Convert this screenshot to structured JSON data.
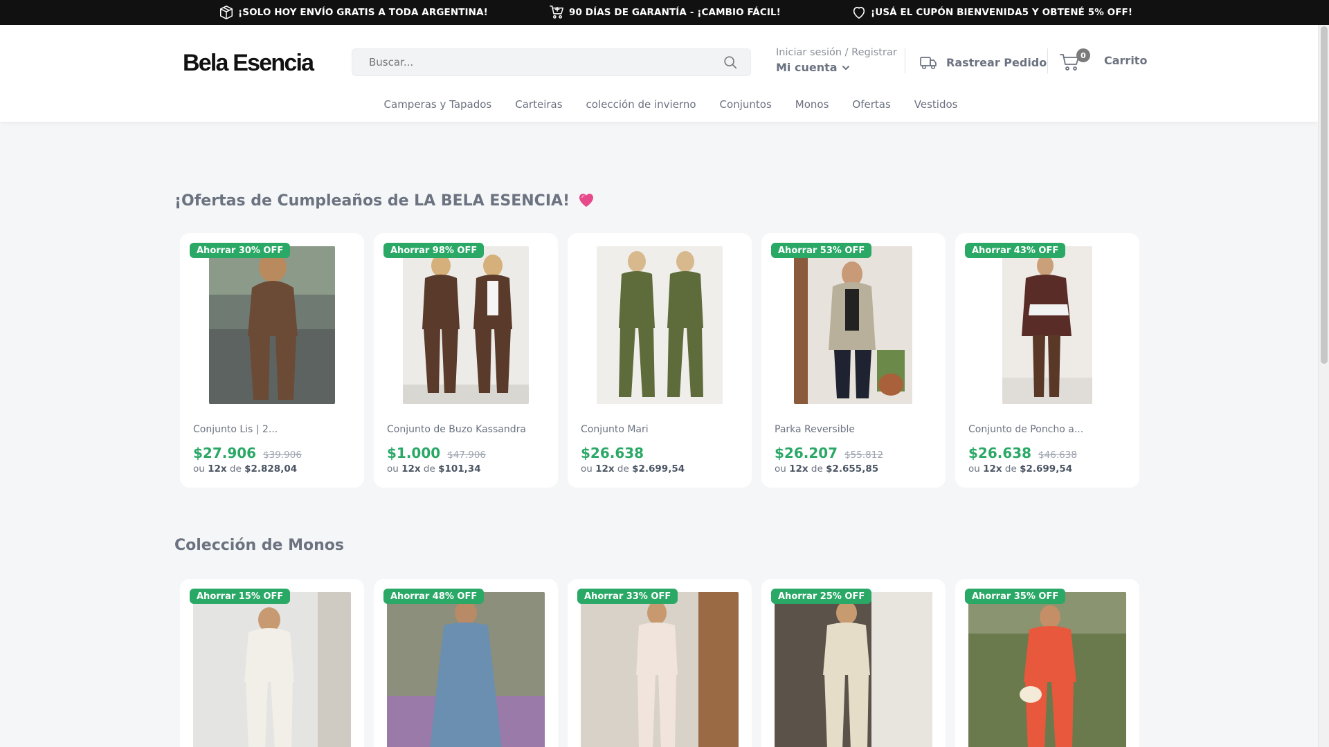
{
  "announcements": [
    {
      "text": "¡SOLO HOY ENVÍO GRATIS A TODA ARGENTINA!",
      "icon": "box-icon"
    },
    {
      "text": "90 DÍAS DE GARANTÍA - ¡CAMBIO FÁCIL!",
      "icon": "cart-icon"
    },
    {
      "text": "¡USÁ EL CUPÓN BIENVENIDA5 Y OBTENÉ 5% OFF!",
      "icon": "heart-icon"
    }
  ],
  "header": {
    "logo": "Bela Esencia",
    "search_placeholder": "Buscar...",
    "login": "Iniciar sesión / Registrar",
    "account": "Mi cuenta",
    "track": "Rastrear Pedido",
    "cart_count": "0",
    "cart_label": "Carrito"
  },
  "nav": [
    "Camperas y Tapados",
    "Carteiras",
    "colección de invierno",
    "Conjuntos",
    "Monos",
    "Ofertas",
    "Vestidos"
  ],
  "nav_first_icon": "",
  "sections": [
    {
      "title": "¡Ofertas de Cumpleaños de LA BELA ESENCIA!",
      "products": [
        {
          "badge": "Ahorrar 30% OFF",
          "name": "Conjunto Lis | 2...",
          "price": "$27.906",
          "old_price": "$39.906",
          "inst_prefix": "ou",
          "inst_count": "12x",
          "inst_de": "de",
          "inst_value": "$2.828,04"
        },
        {
          "badge": "Ahorrar 98% OFF",
          "name": "Conjunto de Buzo Kassandra",
          "price": "$1.000",
          "old_price": "$47.906",
          "inst_prefix": "ou",
          "inst_count": "12x",
          "inst_de": "de",
          "inst_value": "$101,34"
        },
        {
          "badge": "",
          "name": "Conjunto Mari",
          "price": "$26.638",
          "old_price": "",
          "inst_prefix": "ou",
          "inst_count": "12x",
          "inst_de": "de",
          "inst_value": "$2.699,54"
        },
        {
          "badge": "Ahorrar 53% OFF",
          "name": "Parka Reversible",
          "price": "$26.207",
          "old_price": "$55.812",
          "inst_prefix": "ou",
          "inst_count": "12x",
          "inst_de": "de",
          "inst_value": "$2.655,85"
        },
        {
          "badge": "Ahorrar 43% OFF",
          "name": "Conjunto de Poncho a...",
          "price": "$26.638",
          "old_price": "$46.638",
          "inst_prefix": "ou",
          "inst_count": "12x",
          "inst_de": "de",
          "inst_value": "$2.699,54"
        }
      ]
    },
    {
      "title": "Colección de Monos",
      "products": [
        {
          "badge": "Ahorrar 15% OFF"
        },
        {
          "badge": "Ahorrar 48% OFF"
        },
        {
          "badge": "Ahorrar 33% OFF"
        },
        {
          "badge": "Ahorrar 25% OFF"
        },
        {
          "badge": "Ahorrar 35% OFF"
        }
      ]
    }
  ],
  "colors": {
    "accent_green": "#2aa866",
    "topbar": "#111111",
    "heart_pink": "#e64a8b"
  }
}
